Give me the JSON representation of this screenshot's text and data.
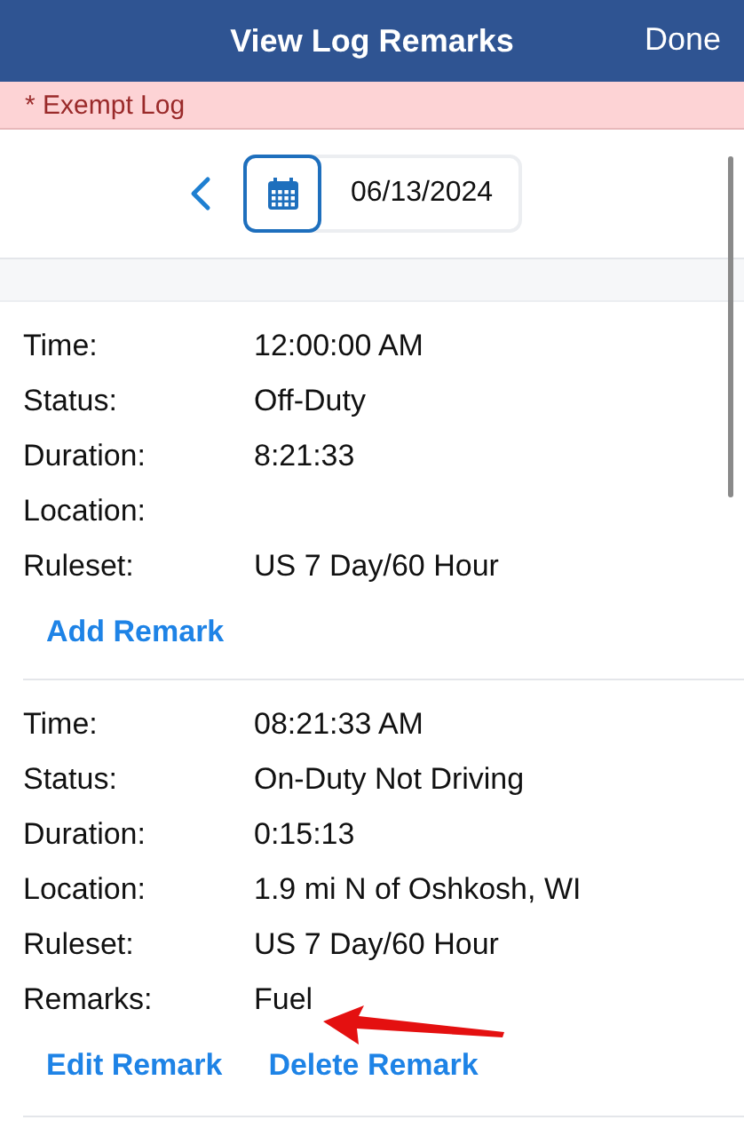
{
  "header": {
    "title": "View Log Remarks",
    "done": "Done"
  },
  "banner": {
    "text": "* Exempt Log"
  },
  "date_picker": {
    "date": "06/13/2024"
  },
  "entries": [
    {
      "fields": [
        {
          "label": "Time:",
          "value": "12:00:00 AM"
        },
        {
          "label": "Status:",
          "value": "Off-Duty"
        },
        {
          "label": "Duration:",
          "value": "8:21:33"
        },
        {
          "label": "Location:"
        },
        {
          "label": "Ruleset:",
          "value": "US 7 Day/60 Hour"
        }
      ],
      "actions": [
        "Add Remark"
      ],
      "annotated": false
    },
    {
      "fields": [
        {
          "label": "Time:",
          "value": "08:21:33 AM"
        },
        {
          "label": "Status:",
          "value": "On-Duty Not Driving"
        },
        {
          "label": "Duration:",
          "value": "0:15:13"
        },
        {
          "label": "Location:",
          "value": "1.9 mi N of Oshkosh, WI"
        },
        {
          "label": "Ruleset:",
          "value": "US 7 Day/60 Hour"
        },
        {
          "label": "Remarks:",
          "value": "Fuel"
        }
      ],
      "actions": [
        "Edit Remark",
        "Delete Remark"
      ],
      "annotated": true
    }
  ]
}
